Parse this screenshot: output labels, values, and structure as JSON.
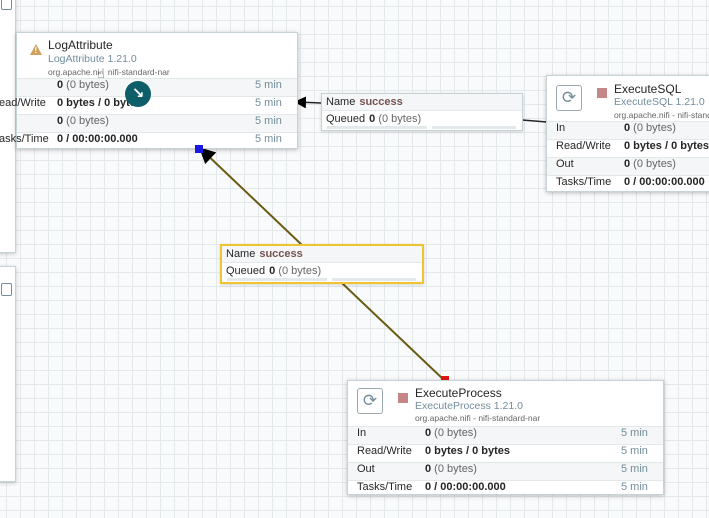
{
  "colors": {
    "source_anchor": "#1a17e0",
    "dest_anchor": "#e01717",
    "selected_border": "#f0c330",
    "stopped": "#c48686",
    "warning": "#cf9f5d",
    "connection_line": "#6b5a13"
  },
  "icons": {
    "warning": "warning-triangle-icon",
    "processor": "processor-icon",
    "stopped": "stop-icon",
    "move_cursor": "arrow-down-right-icon",
    "hand_cursor": "hand-pointer-icon",
    "panel": "panel-icon"
  },
  "log_attribute": {
    "name": "LogAttribute",
    "type": "LogAttribute 1.21.0",
    "bundle_a": "org.apache.ni",
    "bundle_b": " nifi-standard-nar",
    "rows": [
      {
        "label": "",
        "value": "0",
        "value_light": " (0 bytes)",
        "per": "5 min"
      },
      {
        "label": "ead/Write",
        "value": "0 bytes / 0 bytes",
        "value_light": "",
        "per": "5 min"
      },
      {
        "label": "",
        "value": "0",
        "value_light": " (0 bytes)",
        "per": "5 min"
      },
      {
        "label": "asks/Time",
        "value": "0 / 00:00:00.000",
        "value_light": "",
        "per": "5 min"
      }
    ]
  },
  "execute_sql": {
    "name": "ExecuteSQL",
    "type": "ExecuteSQL 1.21.0",
    "bundle": "org.apache.nifi - nifi-standar",
    "rows": [
      {
        "label": "In",
        "value": "0",
        "value_light": " (0 bytes)"
      },
      {
        "label": "Read/Write",
        "value": "0 bytes / 0 bytes",
        "value_light": ""
      },
      {
        "label": "Out",
        "value": "0",
        "value_light": " (0 bytes)"
      },
      {
        "label": "Tasks/Time",
        "value": "0 / 00:00:00.000",
        "value_light": ""
      }
    ]
  },
  "execute_process": {
    "name": "ExecuteProcess",
    "type": "ExecuteProcess 1.21.0",
    "bundle": "org.apache.nifi - nifi-standard-nar",
    "rows": [
      {
        "label": "In",
        "value": "0",
        "value_light": " (0 bytes)",
        "per": "5 min"
      },
      {
        "label": "Read/Write",
        "value": "0 bytes / 0 bytes",
        "value_light": "",
        "per": "5 min"
      },
      {
        "label": "Out",
        "value": "0",
        "value_light": " (0 bytes)",
        "per": "5 min"
      },
      {
        "label": "Tasks/Time",
        "value": "0 / 00:00:00.000",
        "value_light": "",
        "per": "5 min"
      }
    ]
  },
  "connection_sql_to_log": {
    "name_label": "Name",
    "name_value": "success",
    "queued_label": "Queued",
    "queued_value": "0",
    "queued_value_light": " (0 bytes)"
  },
  "connection_process_to_log": {
    "name_label": "Name",
    "name_value": "success",
    "queued_label": "Queued",
    "queued_value": "0",
    "queued_value_light": " (0 bytes)"
  }
}
